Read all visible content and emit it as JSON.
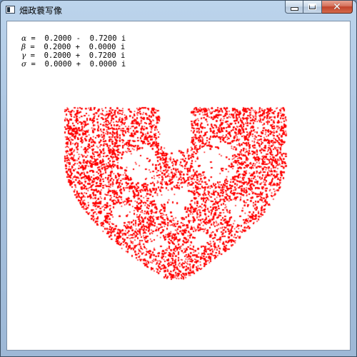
{
  "window": {
    "title": "畑政蓑写像",
    "close_glyph": "✕"
  },
  "parameters": [
    {
      "symbol": "α",
      "rest": " =  0.2000 -  0.7200 i"
    },
    {
      "symbol": "β",
      "rest": " =  0.2000 +  0.0000 i"
    },
    {
      "symbol": "γ",
      "rest": " =  0.2000 +  0.7200 i"
    },
    {
      "symbol": "σ",
      "rest": " =  0.0000 +  0.0000 i"
    }
  ],
  "colors": {
    "fractal": "#ff0000",
    "background": "#ffffff"
  }
}
